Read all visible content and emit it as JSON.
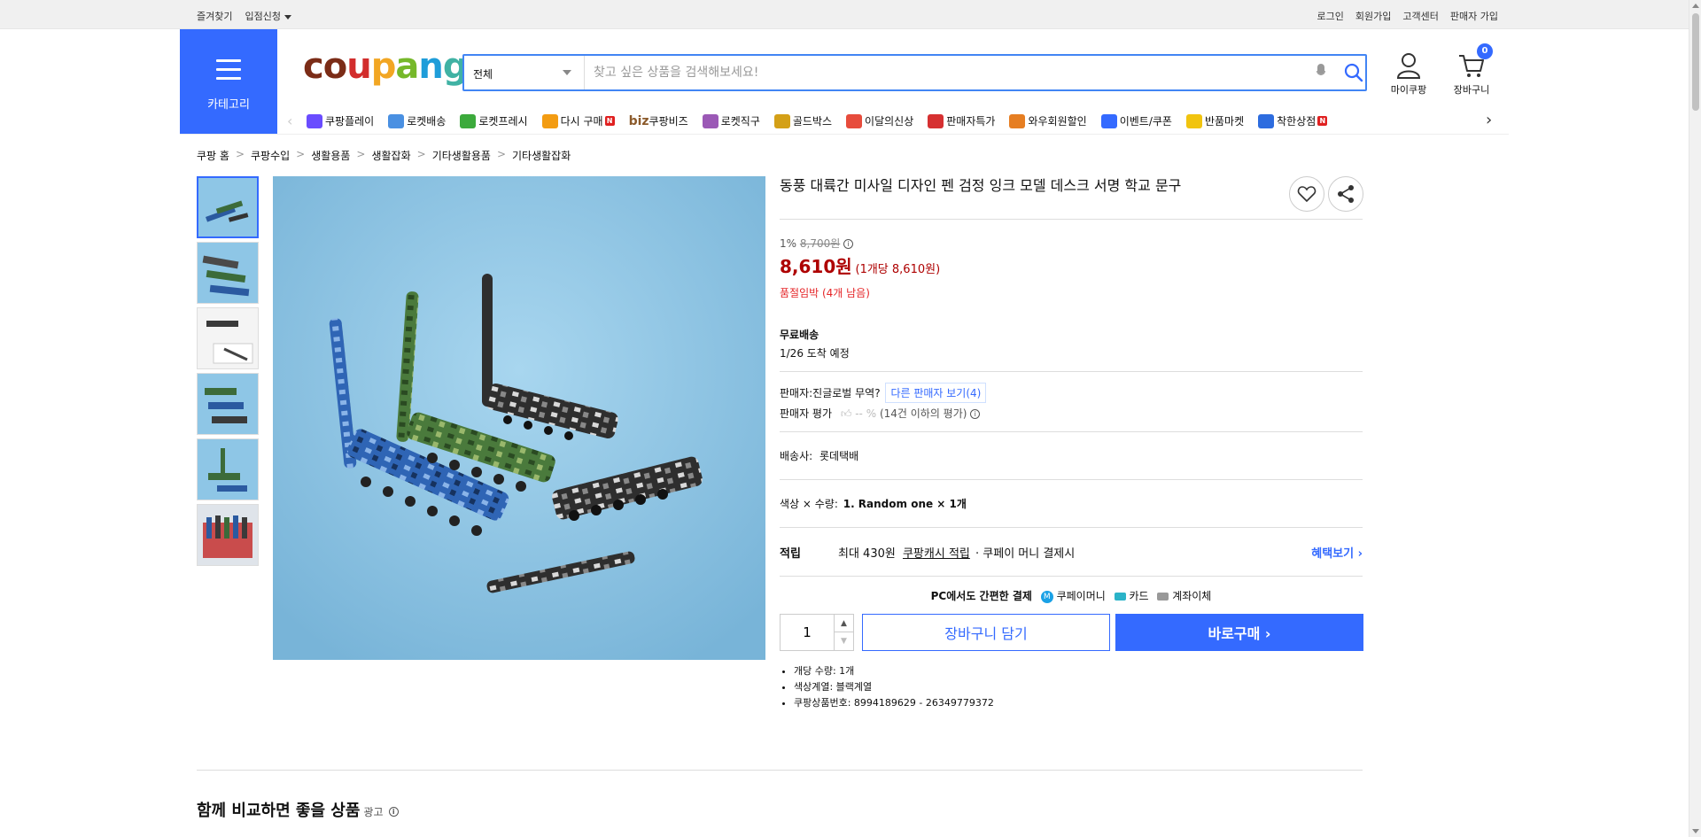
{
  "topbar": {
    "left": [
      "즐겨찾기",
      "입점신청"
    ],
    "right": [
      "로그인",
      "회원가입",
      "고객센터",
      "판매자 가입"
    ]
  },
  "header": {
    "category_label": "카테고리",
    "logo_letters": [
      "c",
      "o",
      "u",
      "p",
      "a",
      "n",
      "g"
    ],
    "logo_colors": [
      "#7b2c17",
      "#7b2c17",
      "#d22d2c",
      "#f2a623",
      "#76b82a",
      "#1f9dd9",
      "#40b2a4"
    ],
    "search_category": "전체",
    "search_placeholder": "찾고 싶은 상품을 검색해보세요!",
    "my_label": "마이쿠팡",
    "cart_label": "장바구니",
    "cart_count": "0"
  },
  "nav": [
    {
      "label": "쿠팡플레이",
      "icon": "play-icon",
      "color": "#6a4cff"
    },
    {
      "label": "로켓배송",
      "icon": "rocket-icon",
      "color": "#4a90e2"
    },
    {
      "label": "로켓프레시",
      "icon": "rocket-fresh-icon",
      "color": "#3caa3c"
    },
    {
      "label": "다시 구매",
      "icon": "house-icon",
      "color": "#f39c12",
      "badge": "N"
    },
    {
      "label": "쿠팡비즈",
      "icon": "biz-icon",
      "color": "#8b5a2b",
      "prefix": "biz"
    },
    {
      "label": "로켓직구",
      "icon": "globe-rocket-icon",
      "color": "#9b59b6"
    },
    {
      "label": "골드박스",
      "icon": "gift-box-icon",
      "color": "#d4a017"
    },
    {
      "label": "이달의신상",
      "icon": "new-bag-icon",
      "color": "#e74c3c"
    },
    {
      "label": "판매자특가",
      "icon": "percent-icon",
      "color": "#d63031"
    },
    {
      "label": "와우회원할인",
      "icon": "wow-icon",
      "color": "#e67e22"
    },
    {
      "label": "이벤트/쿠폰",
      "icon": "coupon-icon",
      "color": "#346aff"
    },
    {
      "label": "반품마켓",
      "icon": "market-icon",
      "color": "#f1c40f"
    },
    {
      "label": "착한상점",
      "icon": "store-icon",
      "color": "#2d6cdf",
      "badge": "N"
    }
  ],
  "breadcrumb": [
    "쿠팡 홈",
    "쿠팡수입",
    "생활용품",
    "생활잡화",
    "기타생활용품",
    "기타생활잡화"
  ],
  "product": {
    "title": "동풍 대륙간 미사일 디자인 펜 검정 잉크 모델 데스크 서명 학교 문구",
    "discount": "1%",
    "old_price": "8,700원",
    "price": "8,610원",
    "unit_price": "(1개당 8,610원)",
    "stock": "품절임박 (4개 남음)",
    "shipping_title": "무료배송",
    "arrival": "1/26 도착 예정",
    "seller_prefix": "판매자:",
    "seller_name": "진글로벌 무역?",
    "other_sellers": "다른 판매자 보기(4)",
    "seller_rating_label": "판매자 평가",
    "seller_rating_value": "-- %",
    "seller_rating_note": "(14건 이하의 평가)",
    "courier_label": "배송사:",
    "courier": "롯데택배",
    "option_label": "색상 × 수량:",
    "option_value": "1. Random one × 1개",
    "reward_label": "적립",
    "reward_text1": "최대 430원",
    "reward_link": "쿠팡캐시 적립",
    "reward_text2": "· 쿠페이 머니 결제시",
    "benefit_link": "혜택보기",
    "pay_title": "PC에서도 간편한 결제",
    "pay_methods": [
      "쿠페이머니",
      "카드",
      "계좌이체"
    ],
    "quantity": "1",
    "cart_button": "장바구니 담기",
    "buy_button": "바로구매",
    "details": [
      "개당 수량: 1개",
      "색상계열: 블랙계열",
      "쿠팡상품번호: 8994189629 - 26349779372"
    ]
  },
  "compare_title": "함께 비교하면 좋을 상품",
  "compare_ad": "광고"
}
